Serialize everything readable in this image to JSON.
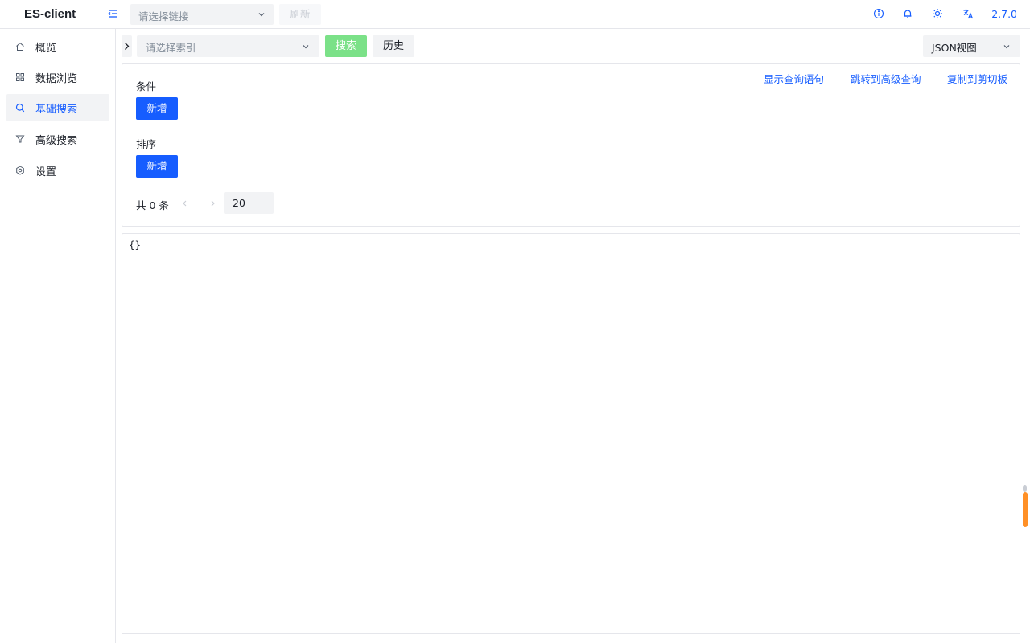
{
  "header": {
    "logo": "ES-client",
    "connection_placeholder": "请选择链接",
    "refresh_label": "刷新",
    "version": "2.7.0",
    "icons": [
      "menu-fold-icon",
      "info-icon",
      "bell-icon",
      "sun-icon",
      "translate-icon"
    ]
  },
  "sidebar": {
    "items": [
      {
        "label": "概览",
        "icon": "home-icon",
        "active": false
      },
      {
        "label": "数据浏览",
        "icon": "grid-icon",
        "active": false
      },
      {
        "label": "基础搜索",
        "icon": "search-icon",
        "active": true
      },
      {
        "label": "高级搜索",
        "icon": "filter-icon",
        "active": false
      },
      {
        "label": "设置",
        "icon": "settings-icon",
        "active": false
      }
    ]
  },
  "toolbar": {
    "index_placeholder": "请选择索引",
    "search_label": "搜索",
    "history_label": "历史",
    "view_mode": "JSON视图"
  },
  "query": {
    "links": {
      "show_query": "显示查询语句",
      "goto_advanced": "跳转到高级查询",
      "copy_clipboard": "复制到剪切板"
    },
    "conditions_label": "条件",
    "conditions_add": "新增",
    "sort_label": "排序",
    "sort_add": "新增",
    "pager_total": "共 0 条",
    "page_size": "20"
  },
  "result": {
    "json_text": "{}"
  },
  "colors": {
    "primary": "#165dff",
    "search_button": "#7be188",
    "border": "#e5e6eb",
    "scroll_accent": "#ff7d00"
  }
}
